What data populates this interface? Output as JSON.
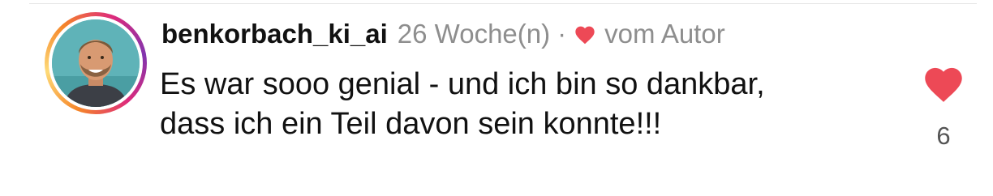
{
  "comment": {
    "username": "benkorbach_ki_ai",
    "time_ago": "26 Woche(n)",
    "separator": "·",
    "author_like_label": "vom Autor",
    "text": "Es war sooo genial - und ich bin so dankbar, dass ich ein Teil davon sein konnte!!!",
    "like_count": "6",
    "liked": true
  },
  "icons": {
    "author_heart": "heart-filled-icon",
    "like": "heart-filled-icon"
  },
  "colors": {
    "heart": "#ed4956",
    "meta_gray": "#8e8e8e",
    "text": "#111111"
  }
}
